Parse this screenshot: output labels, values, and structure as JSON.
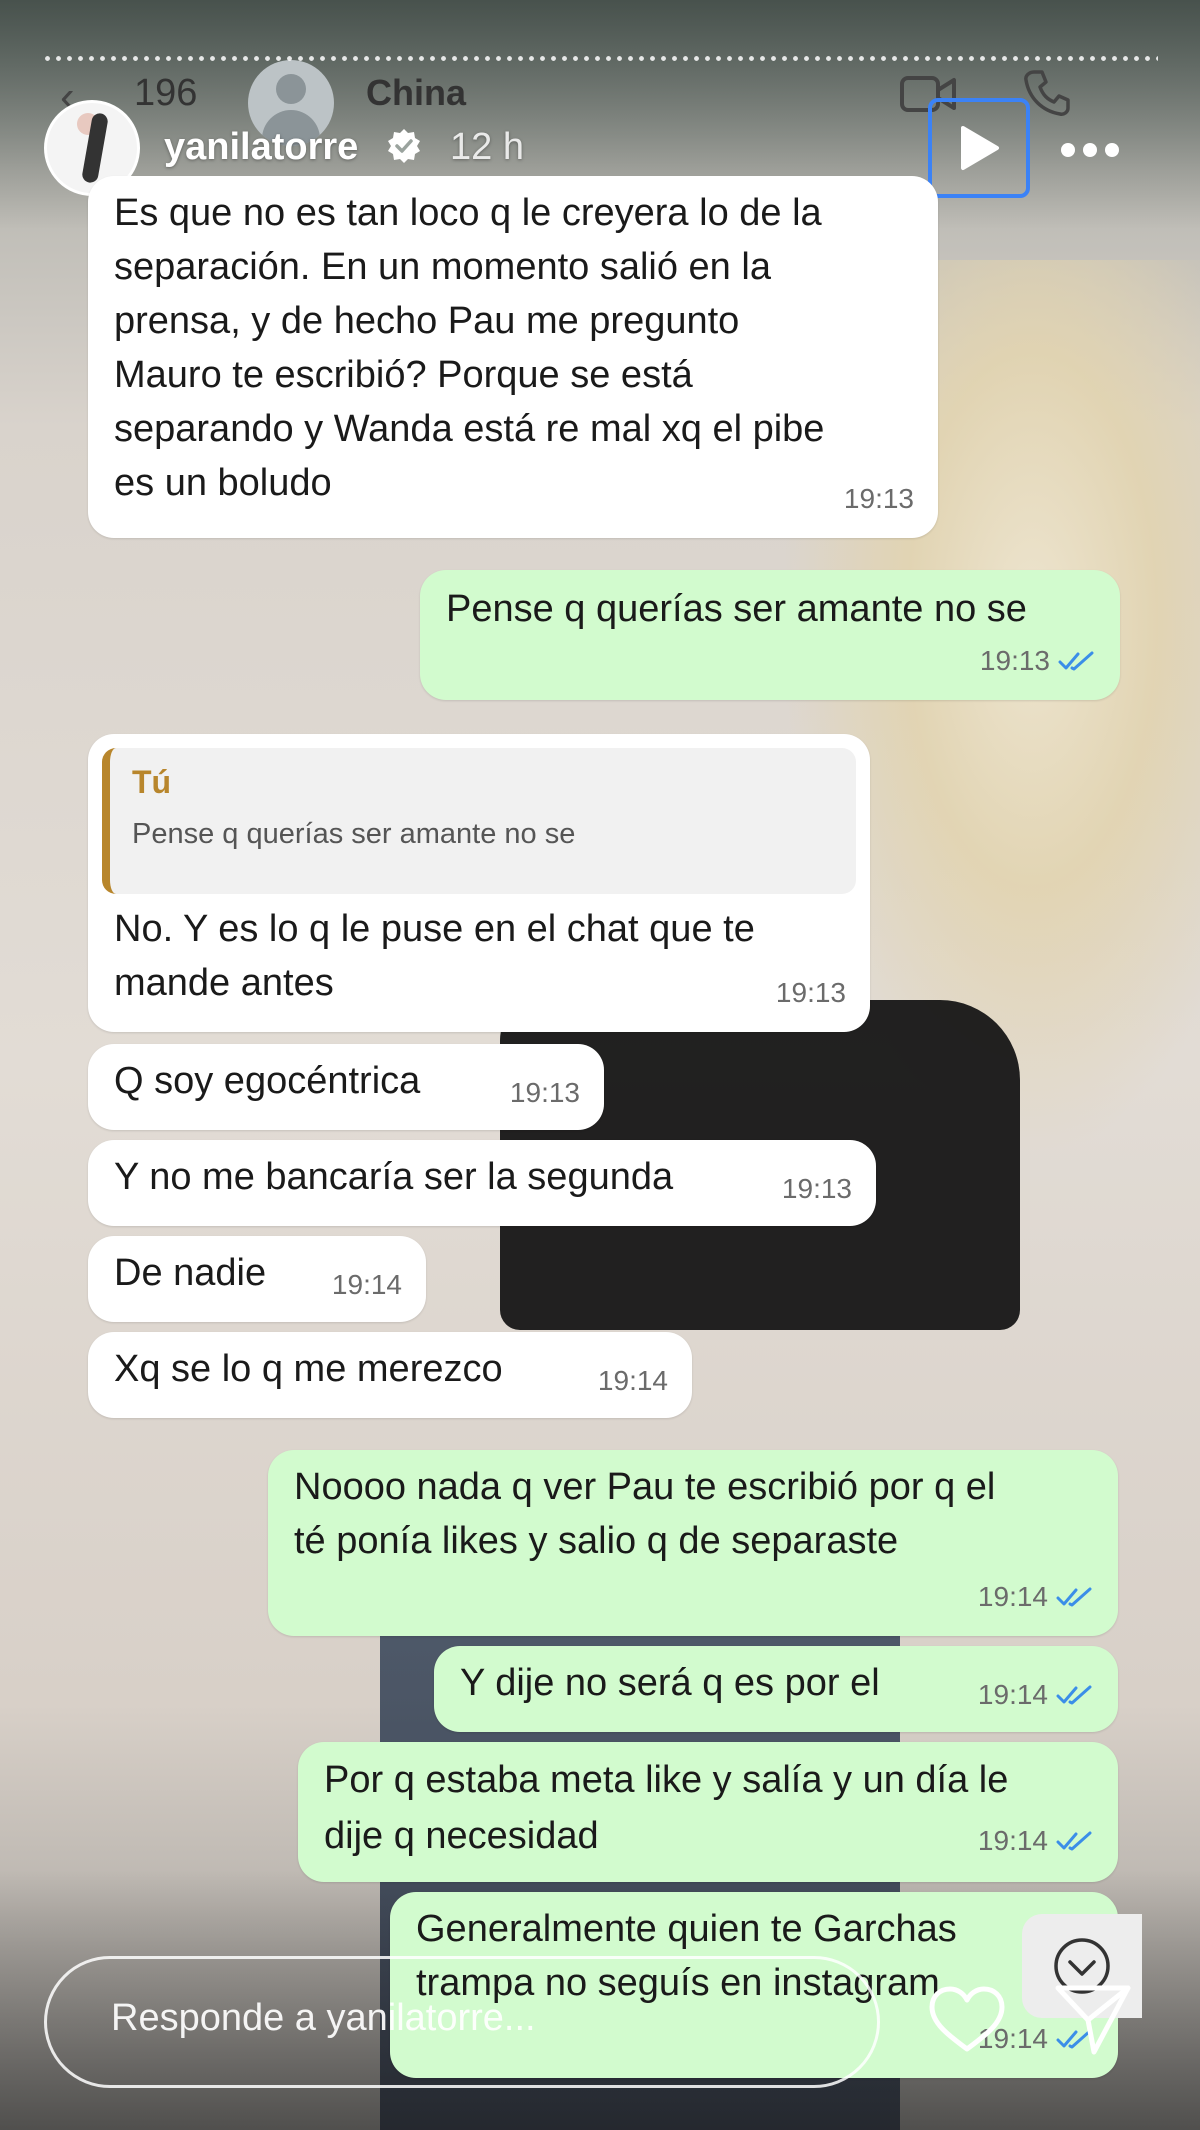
{
  "chat_header": {
    "back_count": "196",
    "contact_name": "China"
  },
  "story": {
    "username": "yanilatorre",
    "time_ago": "12 h",
    "reply_placeholder": "Responde a yanilatorre..."
  },
  "messages": [
    {
      "dir": "in",
      "text": "Es que no es tan loco q le creyera lo de la\nseparación. En un momento salió en la\nprensa, y de hecho Pau me pregunto\nMauro te escribió? Porque se está\nseparando y Wanda está re mal xq el pibe\nes un boludo",
      "time": "19:13"
    },
    {
      "dir": "out",
      "text": "Pense q querías ser amante no se",
      "time": "19:13"
    },
    {
      "dir": "in",
      "quote_author": "Tú",
      "quote_text": "Pense q querías ser amante no se",
      "text": "No. Y es lo q le puse en el chat que te\nmande antes",
      "time": "19:13"
    },
    {
      "dir": "in",
      "text": "Q soy egocéntrica",
      "time": "19:13"
    },
    {
      "dir": "in",
      "text": "Y no me bancaría ser la segunda",
      "time": "19:13"
    },
    {
      "dir": "in",
      "text": "De nadie",
      "time": "19:14"
    },
    {
      "dir": "in",
      "text": "Xq se lo q me merezco",
      "time": "19:14"
    },
    {
      "dir": "out",
      "text": "Noooo nada q ver Pau te escribió por q el\nté ponía likes y salio q de separaste",
      "time": "19:14"
    },
    {
      "dir": "out",
      "text": "Y dije no será q es por el",
      "time": "19:14"
    },
    {
      "dir": "out",
      "text": "Por q estaba meta like y salía y un día le\ndije q necesidad",
      "time": "19:14"
    },
    {
      "dir": "out",
      "text": "Generalmente quien te Garchas\ntrampa no seguís en instagram",
      "time": "19:14"
    }
  ],
  "colors": {
    "incoming_bubble": "#ffffff",
    "outgoing_bubble": "#d2fbce",
    "read_ticks": "#3b8ee8",
    "quote_accent": "#b8862c",
    "focus_outline": "#3b82f6"
  },
  "icons": [
    "back-chevron-icon",
    "contact-avatar-icon",
    "video-call-icon",
    "phone-icon",
    "verified-badge-icon",
    "play-icon",
    "more-options-icon",
    "double-check-icon",
    "scroll-down-icon",
    "heart-icon",
    "send-icon"
  ]
}
